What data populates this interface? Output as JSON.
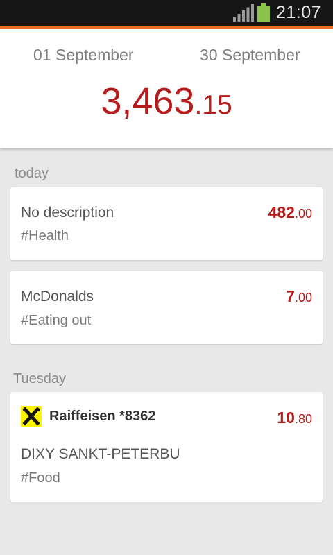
{
  "status_bar": {
    "time": "21:07",
    "battery_color": "#8bc34a",
    "accent_color": "#e8701c"
  },
  "period": {
    "from": "01 September",
    "to": "30 September"
  },
  "total": {
    "whole": "3,463",
    "cents": ".15",
    "color": "#b71c1c"
  },
  "sections": [
    {
      "label": "today",
      "items": [
        {
          "title": "No description",
          "tag": "#Health",
          "amount_whole": "482",
          "amount_cents": ".00"
        },
        {
          "title": "McDonalds",
          "tag": "#Eating out",
          "amount_whole": "7",
          "amount_cents": ".00"
        }
      ]
    },
    {
      "label": "Tuesday",
      "items": [
        {
          "bank": "Raiffeisen *8362",
          "bank_logo": "raiffeisen-logo-icon",
          "title": "DIXY SANKT-PETERBU",
          "tag": "#Food",
          "amount_whole": "10",
          "amount_cents": ".80"
        }
      ]
    }
  ]
}
